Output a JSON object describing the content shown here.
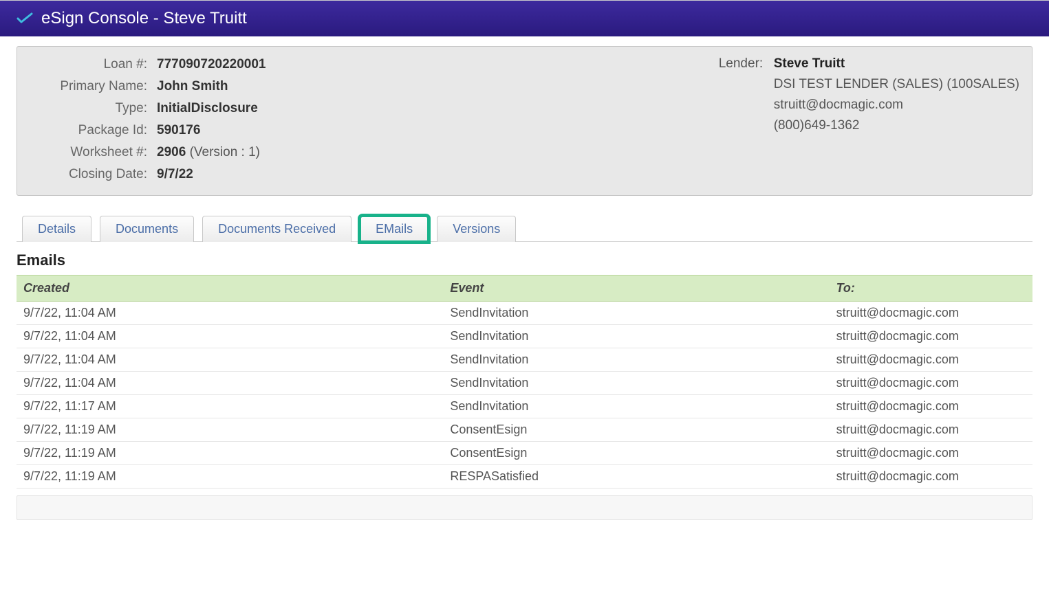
{
  "header": {
    "title": "eSign Console - Steve Truitt"
  },
  "info": {
    "loan_number_label": "Loan #:",
    "loan_number": "777090720220001",
    "primary_name_label": "Primary Name:",
    "primary_name": "John Smith",
    "type_label": "Type:",
    "type": "InitialDisclosure",
    "package_id_label": "Package Id:",
    "package_id": "590176",
    "worksheet_label": "Worksheet #:",
    "worksheet_num": "2906",
    "worksheet_version": "(Version : 1)",
    "closing_date_label": "Closing Date:",
    "closing_date": "9/7/22",
    "lender_label": "Lender:",
    "lender_name": "Steve Truitt",
    "lender_company": "DSI TEST LENDER (SALES) (100SALES)",
    "lender_email": "struitt@docmagic.com",
    "lender_phone": "(800)649-1362"
  },
  "tabs": {
    "details": "Details",
    "documents": "Documents",
    "documents_received": "Documents Received",
    "emails": "EMails",
    "versions": "Versions"
  },
  "section": {
    "title": "Emails"
  },
  "table": {
    "headers": {
      "created": "Created",
      "event": "Event",
      "to": "To:"
    },
    "rows": [
      {
        "created": "9/7/22, 11:04 AM",
        "event": "SendInvitation",
        "to": "struitt@docmagic.com"
      },
      {
        "created": "9/7/22, 11:04 AM",
        "event": "SendInvitation",
        "to": "struitt@docmagic.com"
      },
      {
        "created": "9/7/22, 11:04 AM",
        "event": "SendInvitation",
        "to": "struitt@docmagic.com"
      },
      {
        "created": "9/7/22, 11:04 AM",
        "event": "SendInvitation",
        "to": "struitt@docmagic.com"
      },
      {
        "created": "9/7/22, 11:17 AM",
        "event": "SendInvitation",
        "to": "struitt@docmagic.com"
      },
      {
        "created": "9/7/22, 11:19 AM",
        "event": "ConsentEsign",
        "to": "struitt@docmagic.com"
      },
      {
        "created": "9/7/22, 11:19 AM",
        "event": "ConsentEsign",
        "to": "struitt@docmagic.com"
      },
      {
        "created": "9/7/22, 11:19 AM",
        "event": "RESPASatisfied",
        "to": "struitt@docmagic.com"
      }
    ]
  }
}
